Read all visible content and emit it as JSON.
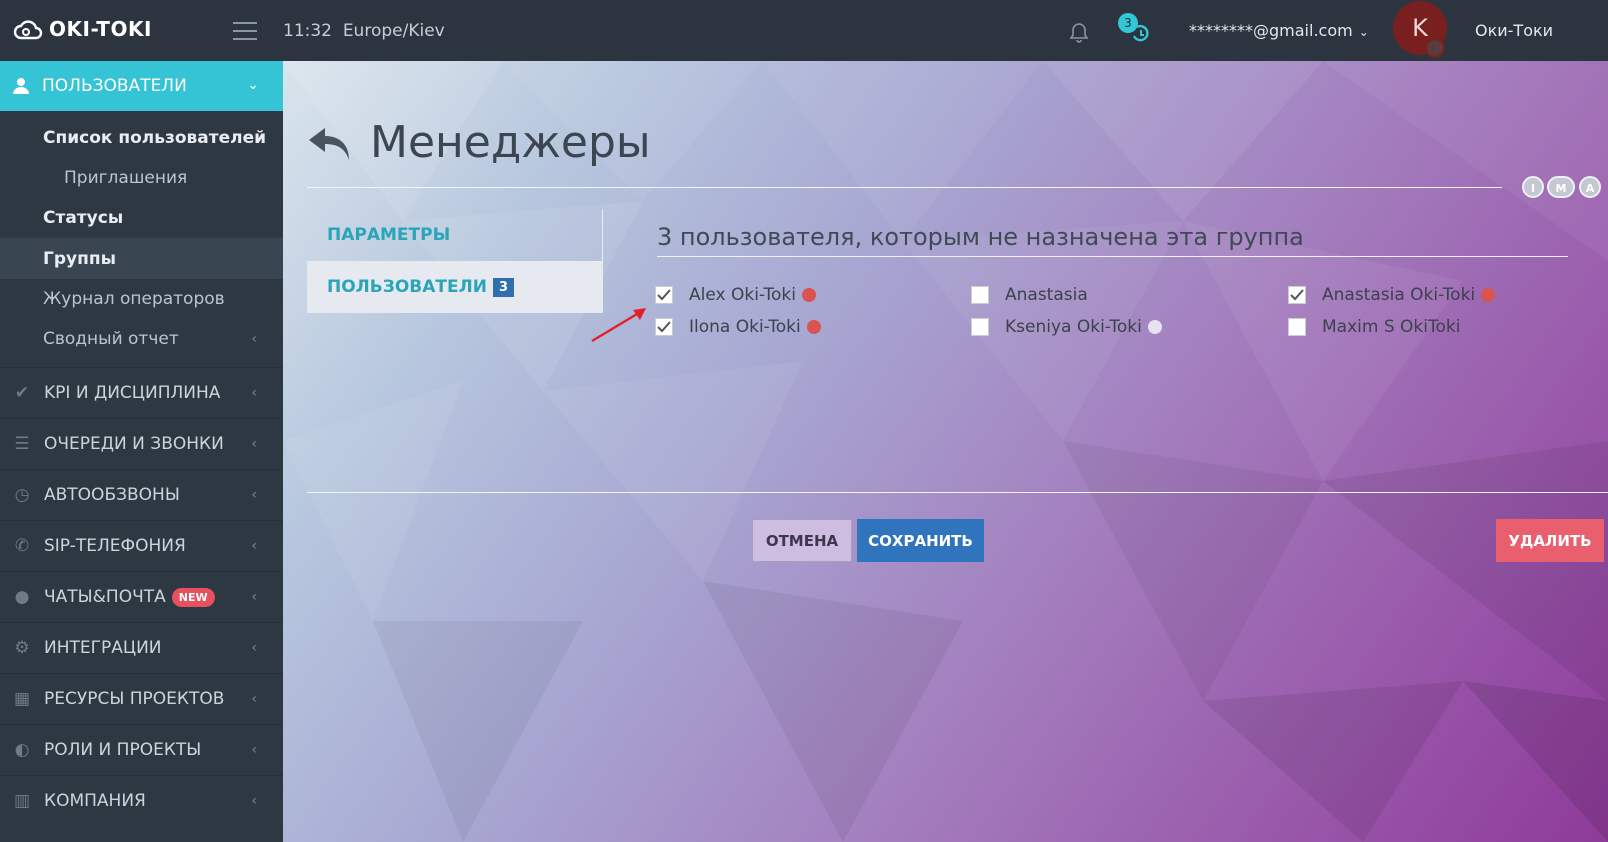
{
  "topbar": {
    "logo_text": "OKI-TOKI",
    "time": "11:32",
    "timezone": "Europe/Kiev",
    "timer_badge": "3",
    "email": "********@gmail.com",
    "avatar_letter": "K",
    "username": "Оки-Токи"
  },
  "sidebar": {
    "active_section": "ПОЛЬЗОВАТЕЛИ",
    "sub_items": [
      {
        "label": "Список пользователей"
      },
      {
        "label": "Приглашения"
      },
      {
        "label": "Статусы"
      },
      {
        "label": "Группы"
      },
      {
        "label": "Журнал операторов"
      },
      {
        "label": "Сводный отчет"
      }
    ],
    "menu": [
      {
        "label": "KPI И ДИСЦИПЛИНА",
        "icon": "check-icon"
      },
      {
        "label": "ОЧЕРЕДИ И ЗВОНКИ",
        "icon": "list-icon"
      },
      {
        "label": "АВТООБЗВОНЫ",
        "icon": "clock-icon"
      },
      {
        "label": "SIP-ТЕЛЕФОНИЯ",
        "icon": "phone-icon"
      },
      {
        "label": "ЧАТЫ&ПОЧТА",
        "icon": "chat-icon",
        "badge": "NEW"
      },
      {
        "label": "ИНТЕГРАЦИИ",
        "icon": "gears-icon"
      },
      {
        "label": "РЕСУРСЫ ПРОЕКТОВ",
        "icon": "grid-icon"
      },
      {
        "label": "РОЛИ И ПРОЕКТЫ",
        "icon": "toggle-icon"
      },
      {
        "label": "КОМПАНИЯ",
        "icon": "bar-chart-icon"
      }
    ]
  },
  "page": {
    "title": "Менеджеры",
    "view_modes": [
      "I",
      "M",
      "A"
    ],
    "tabs": [
      {
        "label": "ПАРАМЕТРЫ"
      },
      {
        "label": "ПОЛЬЗОВАТЕЛИ",
        "count": "3"
      }
    ],
    "section_title": "3 пользователя, которым не назначена эта группа",
    "users": [
      {
        "name": "Alex Oki-Toki",
        "checked": true,
        "status_color": "#d9534f"
      },
      {
        "name": "Anastasia",
        "checked": false,
        "status_color": ""
      },
      {
        "name": "Anastasia Oki-Toki",
        "checked": true,
        "status_color": "#d9534f"
      },
      {
        "name": "Ilona Oki-Toki",
        "checked": true,
        "status_color": "#d9534f"
      },
      {
        "name": "Kseniya Oki-Toki",
        "checked": false,
        "status_color": "#e6e3ee"
      },
      {
        "name": "Maxim S OkiToki",
        "checked": false,
        "status_color": ""
      }
    ],
    "buttons": {
      "cancel": "ОТМЕНА",
      "save": "СОХРАНИТЬ",
      "delete": "УДАЛИТЬ"
    }
  }
}
